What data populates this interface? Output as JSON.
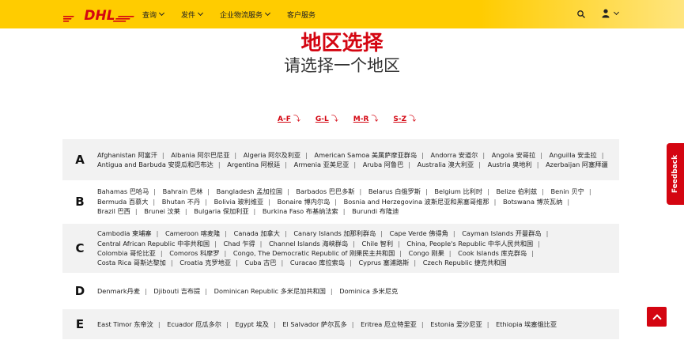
{
  "header": {
    "logo_text": "DHL",
    "nav": [
      "查询",
      "发件",
      "企业物流服务",
      "客户服务"
    ],
    "nav_has_dropdown": [
      true,
      true,
      true,
      false
    ],
    "brand_yellow": "#ffcc00",
    "brand_red": "#d40511"
  },
  "page": {
    "title": "地区选择",
    "subtitle": "请选择一个地区"
  },
  "az_links": [
    "A-F",
    "G-L",
    "M-R",
    "S-Z"
  ],
  "sections": [
    {
      "letter": "A",
      "countries": [
        "Afghanistan 阿富汗",
        "Albania 阿尔巴尼亚",
        "Algeria 阿尔及利亚",
        "American Samoa 美属萨摩亚群岛",
        "Andorra 安道尔",
        "Angola 安哥拉",
        "Anguilla 安圭拉",
        "Antigua and Barbuda 安提瓜和巴布达",
        "Argentina 阿根廷",
        "Armenia 亚美尼亚",
        "Aruba 阿鲁巴",
        "Australia 澳大利亚",
        "Austria 奥地利",
        "Azerbaijan 阿塞拜疆"
      ]
    },
    {
      "letter": "B",
      "countries": [
        "Bahamas 巴哈马",
        "Bahrain 巴林",
        "Bangladesh 孟加拉国",
        "Barbados 巴巴多斯",
        "Belarus 白俄罗斯",
        "Belgium 比利时",
        "Belize 伯利兹",
        "Benin 贝宁",
        "Bermuda 百慕大",
        "Bhutan 不丹",
        "Bolivia 玻利维亚",
        "Bonaire 博内尔岛",
        "Bosnia and Herzegovina 波斯尼亚和黑塞哥维那",
        "Botswana 博茨瓦纳",
        "Brazil 巴西",
        "Brunei 汶莱",
        "Bulgaria 保加利亚",
        "Burkina Faso 布基纳法索",
        "Burundi 布隆迪"
      ]
    },
    {
      "letter": "C",
      "countries": [
        "Cambodia 柬埔寨",
        "Cameroon 喀麦隆",
        "Canada 加拿大",
        "Canary Islands 加那利群岛",
        "Cape Verde 佛得角",
        "Cayman Islands 开曼群岛",
        "Central African Republic 中非共和国",
        "Chad 乍得",
        "Channel Islands 海峡群岛",
        "Chile 智利",
        "China, People's Republic 中华人民共和国",
        "Colombia 哥伦比亚",
        "Comoros 科摩罗",
        "Congo, The Democratic Republic of 刚果民主共和国",
        "Congo 刚果",
        "Cook Islands 库克群岛",
        "Costa Rica 哥斯达黎加",
        "Croatia 克罗地亚",
        "Cuba 古巴",
        "Curacao 库拉索岛",
        "Cyprus 塞浦路斯",
        "Czech Republic 捷克共和国"
      ]
    },
    {
      "letter": "D",
      "countries": [
        "Denmark丹麦",
        "Djibouti 吉布提",
        "Dominican Republic 多米尼加共和国",
        "Dominica 多米尼克"
      ]
    },
    {
      "letter": "E",
      "countries": [
        "East Timor 东帝汶",
        "Ecuador 厄瓜多尔",
        "Egypt 埃及",
        "El Salvador 萨尔瓦多",
        "Eritrea 厄立特里亚",
        "Estonia 爱沙尼亚",
        "Ethiopia 埃塞俄比亚"
      ]
    }
  ],
  "feedback": {
    "label": "Feedback"
  }
}
